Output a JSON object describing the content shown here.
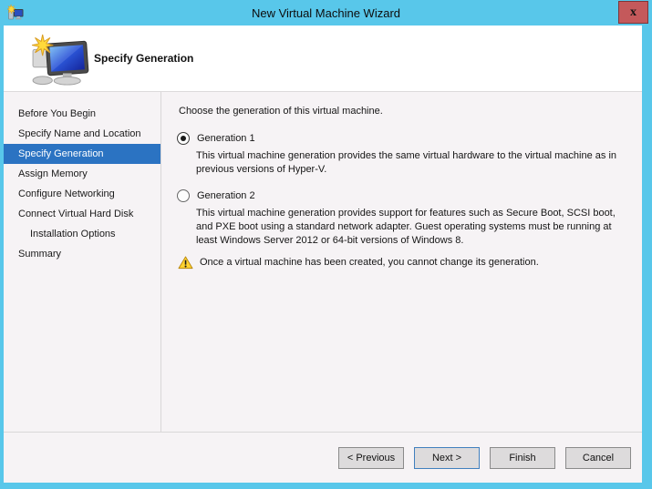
{
  "window": {
    "title": "New Virtual Machine Wizard",
    "close_glyph": "x"
  },
  "header": {
    "title": "Specify Generation"
  },
  "sidebar": {
    "items": [
      {
        "label": "Before You Begin",
        "selected": false,
        "indented": false
      },
      {
        "label": "Specify Name and Location",
        "selected": false,
        "indented": false
      },
      {
        "label": "Specify Generation",
        "selected": true,
        "indented": false
      },
      {
        "label": "Assign Memory",
        "selected": false,
        "indented": false
      },
      {
        "label": "Configure Networking",
        "selected": false,
        "indented": false
      },
      {
        "label": "Connect Virtual Hard Disk",
        "selected": false,
        "indented": false
      },
      {
        "label": "Installation Options",
        "selected": false,
        "indented": true
      },
      {
        "label": "Summary",
        "selected": false,
        "indented": false
      }
    ]
  },
  "content": {
    "intro": "Choose the generation of this virtual machine.",
    "options": [
      {
        "label": "Generation 1",
        "selected": true,
        "description": "This virtual machine generation provides the same virtual hardware to the virtual machine as in previous versions of Hyper-V."
      },
      {
        "label": "Generation 2",
        "selected": false,
        "description": "This virtual machine generation provides support for features such as Secure Boot, SCSI boot, and PXE boot using a standard network adapter. Guest operating systems must be running at least Windows Server 2012 or 64-bit versions of Windows 8."
      }
    ],
    "warning": "Once a virtual machine has been created, you cannot change its generation."
  },
  "footer": {
    "buttons": [
      {
        "label": "< Previous",
        "focused": false
      },
      {
        "label": "Next >",
        "focused": true
      },
      {
        "label": "Finish",
        "focused": false
      },
      {
        "label": "Cancel",
        "focused": false
      }
    ]
  },
  "colors": {
    "titlebar_blue": "#58C7EA",
    "selection_blue": "#2B73C2",
    "close_button_red": "#C4595B",
    "focus_border_blue": "#4180BE",
    "warning_yellow": "#FFD330",
    "body_background": "#F6F3F5"
  }
}
